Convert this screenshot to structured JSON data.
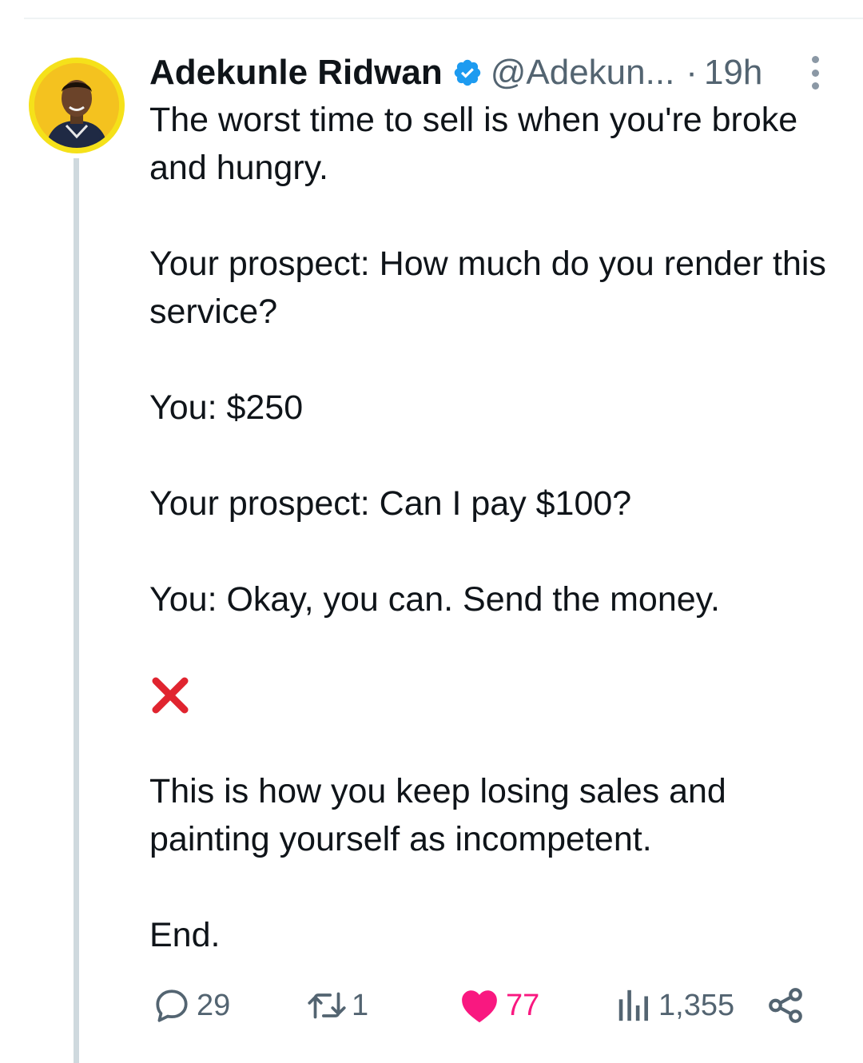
{
  "tweet": {
    "author_name": "Adekunle Ridwan",
    "handle": "@Adekun...",
    "separator": "·",
    "time": "19h",
    "verified_color": "#1d9bf0",
    "avatar_ring_color": "#f5e11a",
    "paragraphs": [
      "The worst time to sell is when you're broke and hungry.",
      "Your prospect: How much do you render this service?",
      "You: $250",
      "Your prospect: Can I pay $100?",
      "You: Okay, you can. Send the money.",
      "This is how you keep losing sales and painting yourself as incompetent.",
      "End."
    ],
    "emoji": "cross-mark-icon"
  },
  "actions": {
    "replies": "29",
    "reposts": "1",
    "likes": "77",
    "views": "1,355",
    "like_color": "#f91880",
    "muted_color": "#536471"
  }
}
